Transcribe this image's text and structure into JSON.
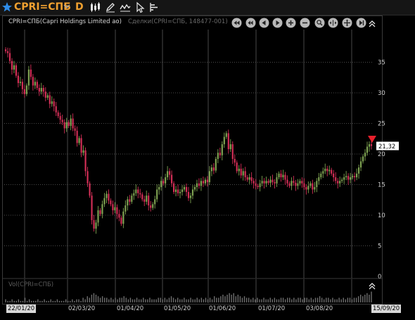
{
  "toolbar": {
    "symbol": "CPRI=СПБ",
    "interval": "D"
  },
  "chart_header": {
    "title": "CPRI=СПБ(Capri Holdings Limited ао)",
    "trades_label": "Сделки(CPRI=СПБ, 148477-001)"
  },
  "volume_label": "Vol(CPRI=СПБ)",
  "last_price_label": "21,32",
  "axis": {
    "x_start_date": "22/01/20",
    "x_end_date": "15/09/20",
    "x_ticks": [
      "02/03/20",
      "01/04/20",
      "01/05/20",
      "01/06/20",
      "01/07/20",
      "03/08/20"
    ],
    "y_ticks": [
      "0",
      "5",
      "10",
      "15",
      "20",
      "25",
      "30",
      "35"
    ]
  },
  "colors": {
    "background": "#000000",
    "up": "#7fa352",
    "down": "#d42f57",
    "accent": "#f0a030",
    "marker": "#e8202c",
    "grid": "#4a4a4a"
  },
  "chart_data": {
    "type": "candlestick",
    "title": "CPRI=СПБ(Capri Holdings Limited ао)",
    "x_start": "22/01/20",
    "x_end": "15/09/20",
    "ylim": [
      0,
      40
    ],
    "grid": true,
    "last_price": 21.32,
    "closes": [
      36.8,
      36.5,
      35.2,
      33.8,
      34.5,
      32.8,
      31.6,
      31.8,
      30.6,
      29.8,
      31.2,
      33.8,
      32.6,
      31.2,
      31.8,
      30.8,
      30.2,
      30.8,
      30.2,
      29.2,
      29.6,
      28.2,
      28.6,
      27.8,
      26.8,
      26.2,
      25.6,
      25.2,
      24.2,
      25.2,
      24.6,
      25.8,
      24.2,
      23.8,
      21.8,
      22.6,
      20.2,
      20.6,
      17.2,
      15.2,
      13.2,
      9.2,
      7.8,
      8.8,
      10.8,
      10.2,
      11.8,
      12.8,
      13.5,
      12.4,
      11.8,
      10.8,
      11.3,
      10.2,
      9.6,
      8.6,
      10.6,
      11.6,
      12.6,
      12.2,
      13.2,
      13.6,
      14.2,
      13.6,
      13.4,
      12.6,
      12.2,
      13.2,
      11.6,
      11.2,
      11.8,
      12.6,
      14.2,
      14.6,
      15.6,
      15.2,
      16.2,
      17.2,
      16.6,
      15.2,
      13.8,
      14.2,
      13.6,
      13.8,
      14.2,
      14.6,
      13.8,
      12.8,
      13.2,
      14.2,
      14.6,
      15.2,
      14.8,
      15.6,
      15.2,
      15.8,
      15.4,
      17.2,
      17.8,
      17.3,
      19.2,
      20.2,
      19.8,
      21.6,
      22.8,
      23.4,
      20.8,
      21.6,
      19.2,
      18.6,
      17.2,
      17.6,
      16.5,
      17.2,
      16.2,
      15.8,
      16.2,
      15.6,
      15.2,
      14.8,
      14.6,
      15.2,
      15.6,
      15.2,
      15.6,
      15.3,
      15.8,
      15.4,
      15.2,
      16.2,
      16.8,
      16.2,
      16.6,
      15.8,
      15.2,
      14.8,
      15.6,
      15.3,
      14.8,
      15.2,
      15.6,
      15.2,
      14.6,
      14.2,
      14.8,
      15.2,
      14.2,
      14.6,
      15.6,
      16.2,
      16.8,
      17.2,
      17.6,
      17.2,
      17.4,
      16.8,
      16.2,
      15.6,
      15.2,
      15.6,
      15.8,
      16.2,
      16.4,
      15.8,
      16.2,
      16.4,
      16.2,
      16.8,
      17.8,
      18.8,
      19.6,
      20.2,
      21.2,
      21.6,
      21.32
    ],
    "volumes": [
      2,
      1,
      1,
      2,
      1,
      1,
      2,
      1,
      1,
      3,
      1,
      2,
      1,
      1,
      1,
      2,
      1,
      1,
      2,
      1,
      1,
      2,
      1,
      1,
      2,
      1,
      1,
      1,
      2,
      1,
      1,
      2,
      1,
      2,
      2,
      1,
      3,
      2,
      4,
      3,
      5,
      6,
      5,
      4,
      3,
      4,
      3,
      3,
      2,
      3,
      2,
      3,
      2,
      3,
      3,
      4,
      3,
      2,
      3,
      2,
      2,
      3,
      2,
      2,
      3,
      2,
      2,
      3,
      2,
      2,
      2,
      3,
      3,
      2,
      3,
      2,
      3,
      4,
      3,
      2,
      3,
      2,
      2,
      3,
      2,
      2,
      3,
      2,
      2,
      3,
      2,
      3,
      2,
      3,
      2,
      3,
      2,
      4,
      3,
      3,
      4,
      5,
      4,
      5,
      6,
      5,
      6,
      4,
      5,
      4,
      3,
      4,
      3,
      3,
      2,
      3,
      2,
      3,
      2,
      2,
      3,
      2,
      2,
      3,
      2,
      3,
      2,
      2,
      3,
      3,
      2,
      3,
      3,
      2,
      3,
      2,
      3,
      3,
      2,
      3,
      3,
      2,
      3,
      2,
      3,
      3,
      4,
      3,
      2,
      3,
      3,
      2,
      3,
      2,
      2,
      3,
      2,
      3,
      2,
      3,
      3,
      2,
      3,
      3,
      4,
      5,
      4,
      5,
      6,
      5,
      7
    ]
  }
}
